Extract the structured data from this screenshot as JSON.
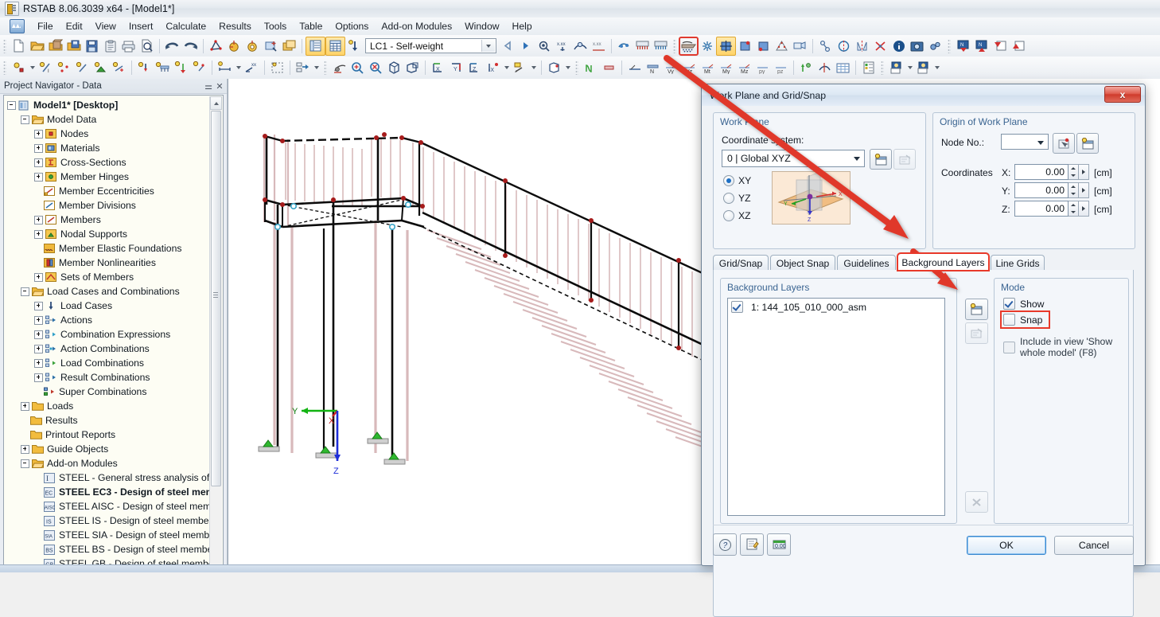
{
  "window": {
    "title": "RSTAB 8.06.3039 x64 - [Model1*]",
    "icon": "rstab-app-icon"
  },
  "menu": {
    "items": [
      {
        "label": "File"
      },
      {
        "label": "Edit"
      },
      {
        "label": "View"
      },
      {
        "label": "Insert"
      },
      {
        "label": "Calculate"
      },
      {
        "label": "Results"
      },
      {
        "label": "Tools"
      },
      {
        "label": "Table"
      },
      {
        "label": "Options"
      },
      {
        "label": "Add-on Modules"
      },
      {
        "label": "Window"
      },
      {
        "label": "Help"
      }
    ]
  },
  "toolbar": {
    "load_case": {
      "value": "LC1 - Self-weight"
    },
    "highlighted_button": "work-plane-grid-snap"
  },
  "navigator": {
    "title": "Project Navigator - Data",
    "pin_icon": "pin-icon",
    "close_icon": "close-icon",
    "tree": [
      {
        "label": "Model1* [Desktop]",
        "depth": 0,
        "expander": "minus",
        "icon": "model-icon",
        "bold": true
      },
      {
        "label": "Model Data",
        "depth": 1,
        "expander": "minus",
        "icon": "folder-open",
        "bold": false
      },
      {
        "label": "Nodes",
        "depth": 2,
        "expander": "plus",
        "icon": "nodes-icon",
        "bold": false
      },
      {
        "label": "Materials",
        "depth": 2,
        "expander": "plus",
        "icon": "materials-icon",
        "bold": false
      },
      {
        "label": "Cross-Sections",
        "depth": 2,
        "expander": "plus",
        "icon": "cross-sections-icon",
        "bold": false
      },
      {
        "label": "Member Hinges",
        "depth": 2,
        "expander": "plus",
        "icon": "member-hinges-icon",
        "bold": false
      },
      {
        "label": "Member Eccentricities",
        "depth": 2,
        "expander": "none",
        "icon": "member-eccentricities-icon",
        "bold": false
      },
      {
        "label": "Member Divisions",
        "depth": 2,
        "expander": "none",
        "icon": "member-divisions-icon",
        "bold": false
      },
      {
        "label": "Members",
        "depth": 2,
        "expander": "plus",
        "icon": "members-icon",
        "bold": false
      },
      {
        "label": "Nodal Supports",
        "depth": 2,
        "expander": "plus",
        "icon": "nodal-supports-icon",
        "bold": false
      },
      {
        "label": "Member Elastic Foundations",
        "depth": 2,
        "expander": "none",
        "icon": "member-elastic-foundations-icon",
        "bold": false
      },
      {
        "label": "Member Nonlinearities",
        "depth": 2,
        "expander": "none",
        "icon": "member-nonlinearities-icon",
        "bold": false
      },
      {
        "label": "Sets of Members",
        "depth": 2,
        "expander": "plus",
        "icon": "sets-of-members-icon",
        "bold": false
      },
      {
        "label": "Load Cases and Combinations",
        "depth": 1,
        "expander": "minus",
        "icon": "folder-open",
        "bold": false
      },
      {
        "label": "Load Cases",
        "depth": 2,
        "expander": "plus",
        "icon": "load-cases-icon",
        "bold": false
      },
      {
        "label": "Actions",
        "depth": 2,
        "expander": "plus",
        "icon": "actions-icon",
        "bold": false
      },
      {
        "label": "Combination Expressions",
        "depth": 2,
        "expander": "plus",
        "icon": "combination-expressions-icon",
        "bold": false
      },
      {
        "label": "Action Combinations",
        "depth": 2,
        "expander": "plus",
        "icon": "action-combinations-icon",
        "bold": false
      },
      {
        "label": "Load Combinations",
        "depth": 2,
        "expander": "plus",
        "icon": "load-combinations-icon",
        "bold": false
      },
      {
        "label": "Result Combinations",
        "depth": 2,
        "expander": "plus",
        "icon": "result-combinations-icon",
        "bold": false
      },
      {
        "label": "Super Combinations",
        "depth": 2,
        "expander": "none",
        "icon": "super-combinations-icon",
        "bold": false
      },
      {
        "label": "Loads",
        "depth": 1,
        "expander": "plus",
        "icon": "folder",
        "bold": false
      },
      {
        "label": "Results",
        "depth": 1,
        "expander": "none",
        "icon": "folder",
        "bold": false
      },
      {
        "label": "Printout Reports",
        "depth": 1,
        "expander": "none",
        "icon": "folder",
        "bold": false
      },
      {
        "label": "Guide Objects",
        "depth": 1,
        "expander": "plus",
        "icon": "folder",
        "bold": false
      },
      {
        "label": "Add-on Modules",
        "depth": 1,
        "expander": "minus",
        "icon": "folder-open",
        "bold": false
      },
      {
        "label": "STEEL - General stress analysis of s",
        "depth": 2,
        "expander": "none",
        "icon": "module-steel-icon",
        "bold": false
      },
      {
        "label": "STEEL EC3 - Design of steel mem",
        "depth": 2,
        "expander": "none",
        "icon": "module-steel-ec3-icon",
        "bold": true
      },
      {
        "label": "STEEL AISC - Design of steel mem",
        "depth": 2,
        "expander": "none",
        "icon": "module-steel-aisc-icon",
        "bold": false
      },
      {
        "label": "STEEL IS - Design of steel member",
        "depth": 2,
        "expander": "none",
        "icon": "module-steel-is-icon",
        "bold": false
      },
      {
        "label": "STEEL SIA - Design of steel memb",
        "depth": 2,
        "expander": "none",
        "icon": "module-steel-sia-icon",
        "bold": false
      },
      {
        "label": "STEEL BS - Design of steel membe",
        "depth": 2,
        "expander": "none",
        "icon": "module-steel-bs-icon",
        "bold": false
      },
      {
        "label": "STEEL GB - Design of steel membe",
        "depth": 2,
        "expander": "none",
        "icon": "module-steel-gb-icon",
        "bold": false
      }
    ]
  },
  "viewport": {
    "axis_labels": {
      "x": "X",
      "y": "Y",
      "z": "Z"
    },
    "model_description": "3D steel staircase and platform frame model"
  },
  "dialog": {
    "title": "Work Plane and Grid/Snap",
    "close_label": "x",
    "work_plane": {
      "group_title": "Work Plane",
      "coordinate_system_label": "Coordinate system:",
      "coordinate_system_value": "0 | Global XYZ",
      "new_cs_icon": "new-coordinate-system-icon",
      "edit_cs_icon": "edit-coordinate-system-icon",
      "planes": [
        {
          "label": "XY",
          "selected": true
        },
        {
          "label": "YZ",
          "selected": false
        },
        {
          "label": "XZ",
          "selected": false
        }
      ],
      "preview_icon": "work-plane-preview-image"
    },
    "origin": {
      "group_title": "Origin of Work Plane",
      "node_no_label": "Node No.:",
      "node_no_value": "",
      "pick_node_icon": "pick-node-icon",
      "new_node_icon": "new-node-icon",
      "coordinates_label": "Coordinates",
      "rows": [
        {
          "axis": "X:",
          "value": "0.00",
          "unit": "[cm]"
        },
        {
          "axis": "Y:",
          "value": "0.00",
          "unit": "[cm]"
        },
        {
          "axis": "Z:",
          "value": "0.00",
          "unit": "[cm]"
        }
      ]
    },
    "tabs": [
      {
        "label": "Grid/Snap",
        "selected": false,
        "marked": false
      },
      {
        "label": "Object Snap",
        "selected": false,
        "marked": false
      },
      {
        "label": "Guidelines",
        "selected": false,
        "marked": false
      },
      {
        "label": "Background Layers",
        "selected": true,
        "marked": true
      },
      {
        "label": "Line Grids",
        "selected": false,
        "marked": false
      }
    ],
    "background_layers": {
      "group_title": "Background Layers",
      "items": [
        {
          "label": "1: 144_105_010_000_asm",
          "checked": true
        }
      ],
      "new_layer_icon": "new-background-layer-icon",
      "edit_layer_icon": "edit-background-layer-icon",
      "delete_icon": "delete-layer-icon"
    },
    "mode": {
      "group_title": "Mode",
      "options": [
        {
          "label": "Show",
          "checked": true,
          "marked": false
        },
        {
          "label": "Snap",
          "checked": false,
          "marked": true
        },
        {
          "label": "Include in view 'Show whole model' (F8)",
          "checked": false,
          "marked": false
        }
      ]
    },
    "footer": {
      "help_icon": "help-icon",
      "notes_icon": "notes-icon",
      "units_icon": "units-icon",
      "ok_label": "OK",
      "cancel_label": "Cancel"
    }
  },
  "colors": {
    "accent_red": "#e8392a",
    "tab_selected_bg": "#f3f6fa",
    "dialog_bg": "#eff2f6",
    "title_gradient_top": "#eaf1f9",
    "toolbar_active": "#ffd469",
    "model_member": "#c9a9ab",
    "support_green": "#35b734",
    "node_red": "#b41e1e"
  }
}
